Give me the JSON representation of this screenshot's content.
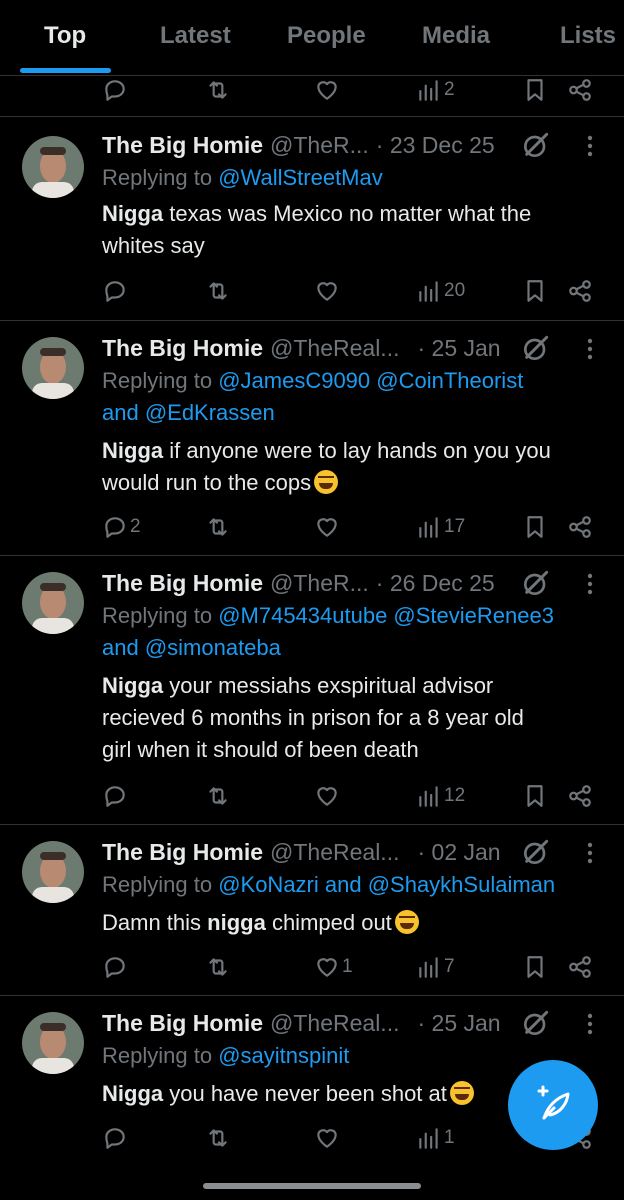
{
  "tabs": [
    {
      "label": "Top",
      "active": true
    },
    {
      "label": "Latest",
      "active": false
    },
    {
      "label": "People",
      "active": false
    },
    {
      "label": "Media",
      "active": false
    },
    {
      "label": "Lists",
      "active": false
    }
  ],
  "top_partial_row": {
    "views": "2"
  },
  "tweets": [
    {
      "name": "The Big Homie",
      "handle": "@TheR...",
      "date": "· 23 Dec 25",
      "reply_prefix": "Replying to ",
      "reply_line1": "@WallStreetMav",
      "reply_line2": "",
      "text_line1_bold": "Nigga",
      "text_line1_rest": " texas was Mexico no matter what the",
      "text_line2": "whites say",
      "replies": "",
      "likes": "",
      "views": "20"
    },
    {
      "name": "The Big Homie",
      "handle": "@TheReal...",
      "date": "· 25 Jan",
      "reply_prefix": "Replying to ",
      "reply_line1": "@JamesC9090 @CoinTheorist",
      "reply_line2": "and @EdKrassen",
      "text_line1_bold": "Nigga",
      "text_line1_rest": " if anyone were to lay hands on you you",
      "text_line2": "would run to the cops",
      "replies": "2",
      "likes": "",
      "views": "17"
    },
    {
      "name": "The Big Homie",
      "handle": "@TheR...",
      "date": "· 26 Dec 25",
      "reply_prefix": "Replying to ",
      "reply_line1": "@M745434utube @StevieRenee3",
      "reply_line2": "and @simonateba",
      "text_line1_bold": "Nigga",
      "text_line1_rest": " your messiahs exspiritual advisor",
      "text_line2": "recieved 6 months in prison for a 8 year old",
      "text_line3": "girl when it should of been death",
      "replies": "",
      "likes": "",
      "views": "12"
    },
    {
      "name": "The Big Homie",
      "handle": "@TheReal...",
      "date": "· 02 Jan",
      "reply_prefix": "Replying to ",
      "reply_line1": "@KoNazri and @ShaykhSulaiman",
      "reply_line2": "",
      "text_pre": "Damn this ",
      "text_bold": "nigga",
      "text_post": " chimped out",
      "replies": "",
      "likes": "1",
      "views": "7"
    },
    {
      "name": "The Big Homie",
      "handle": "@TheReal...",
      "date": "· 25 Jan",
      "reply_prefix": "Replying to ",
      "reply_line1": "@sayitnspinit",
      "reply_line2": "",
      "text_line1_bold": "Nigga",
      "text_line1_rest": " you have never been shot at",
      "replies": "",
      "likes": "",
      "views": "1"
    }
  ],
  "colors": {
    "accent": "#1d9bf0",
    "muted": "#71767b",
    "text": "#e7e9ea",
    "background": "#000000"
  },
  "icons": [
    "reply-icon",
    "retweet-icon",
    "like-icon",
    "views-icon",
    "bookmark-icon",
    "share-icon",
    "grok-icon",
    "more-icon",
    "compose-icon"
  ]
}
